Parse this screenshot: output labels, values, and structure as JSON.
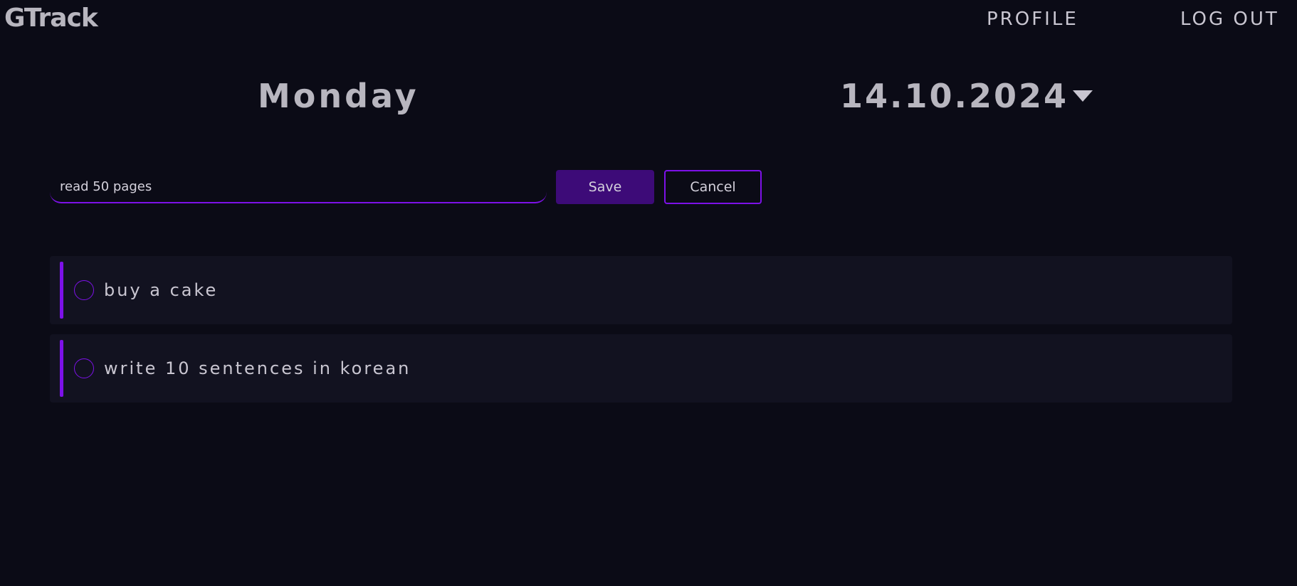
{
  "header": {
    "logo": "GTrack",
    "nav": {
      "profile": "PROFILE",
      "logout": "LOG OUT"
    }
  },
  "day": {
    "name": "Monday",
    "date": "14.10.2024",
    "date_picker_icon": "caret-down-icon"
  },
  "editor": {
    "input_value": "read 50 pages",
    "save_label": "Save",
    "cancel_label": "Cancel"
  },
  "tasks": [
    {
      "text": "buy a cake",
      "done": false
    },
    {
      "text": "write 10 sentences in korean",
      "done": false
    }
  ],
  "colors": {
    "background": "#0b0b16",
    "accent": "#7d11e8",
    "save_button": "#3d0b78",
    "card": "#121220",
    "text": "#c9c6d1"
  }
}
